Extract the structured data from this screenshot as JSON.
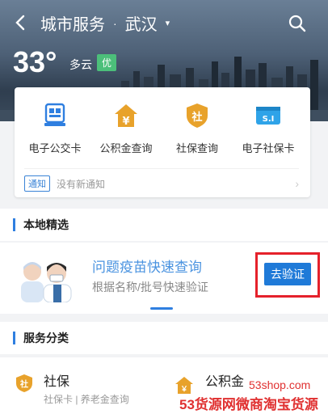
{
  "header": {
    "title": "城市服务",
    "separator": "·",
    "city": "武汉",
    "caret": "▾"
  },
  "weather": {
    "temperature": "33°",
    "condition": "多云",
    "air_quality": "优"
  },
  "quick_actions": [
    {
      "label": "电子公交卡",
      "icon": "bus-card-icon"
    },
    {
      "label": "公积金查询",
      "icon": "housing-fund-icon"
    },
    {
      "label": "社保查询",
      "icon": "social-security-icon"
    },
    {
      "label": "电子社保卡",
      "icon": "social-security-card-icon"
    }
  ],
  "notice": {
    "tag": "通知",
    "text": "没有新通知",
    "arrow": "›"
  },
  "local": {
    "section_title": "本地精选",
    "promo_title": "问题疫苗快速查询",
    "promo_subtitle": "根据名称/批号快速验证",
    "verify_button": "去验证"
  },
  "services": {
    "section_title": "服务分类",
    "items": [
      {
        "title": "社保",
        "subtitle": "社保卡 | 养老金查询",
        "icon_text": "社"
      },
      {
        "title": "公积金",
        "icon_text": "￥"
      }
    ]
  },
  "watermark": {
    "site": "53shop.com",
    "text": "53货源网微商淘宝货源"
  },
  "colors": {
    "accent": "#1f7ad8",
    "gold": "#e8a22b",
    "air_good": "#4cbf7a"
  }
}
